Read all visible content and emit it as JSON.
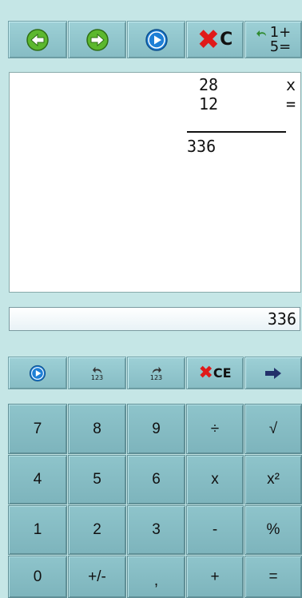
{
  "toolbar": {
    "back": "back-icon",
    "forward": "forward-icon",
    "play": "play-icon",
    "clear_x": "✖",
    "clear_label": "C",
    "history_top": "1+",
    "history_bottom": "5="
  },
  "tape": {
    "operand1": "28",
    "operator1": "x",
    "operand2": "12",
    "operator2": "=",
    "result": "336"
  },
  "display": {
    "value": "336"
  },
  "secondary": {
    "recall_digits": "123",
    "redo_digits": "123",
    "clear_x": "✖",
    "ce_label": "CE"
  },
  "keypad": {
    "rows": [
      [
        "7",
        "8",
        "9",
        "÷",
        "√"
      ],
      [
        "4",
        "5",
        "6",
        "x",
        "x²"
      ],
      [
        "1",
        "2",
        "3",
        "-",
        "%"
      ],
      [
        "0",
        "+/-",
        ",",
        "+",
        "="
      ]
    ]
  },
  "colors": {
    "background": "#c5e6e6",
    "key": "#86bcc4",
    "accent_red": "#e01a1a",
    "accent_blue": "#1e7fd6",
    "accent_green": "#5cb82e"
  }
}
